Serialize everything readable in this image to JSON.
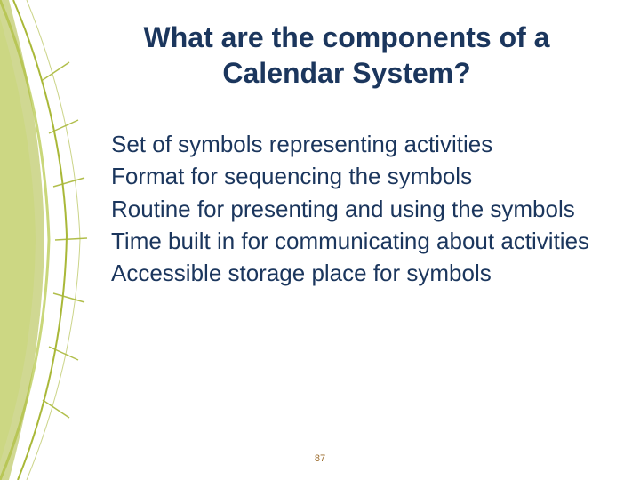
{
  "title_line1": "What are the components of a",
  "title_line2": "Calendar System?",
  "items": [
    "Set of symbols representing activities",
    "Format for sequencing the symbols",
    "Routine for presenting and using the symbols",
    "Time built in for communicating about activities",
    "Accessible storage place for symbols"
  ],
  "page_number": "87",
  "colors": {
    "text": "#1b365d",
    "accent_olive": "#a9b838",
    "accent_olive_light": "#c9d77a",
    "page_num": "#9a6a2a"
  }
}
